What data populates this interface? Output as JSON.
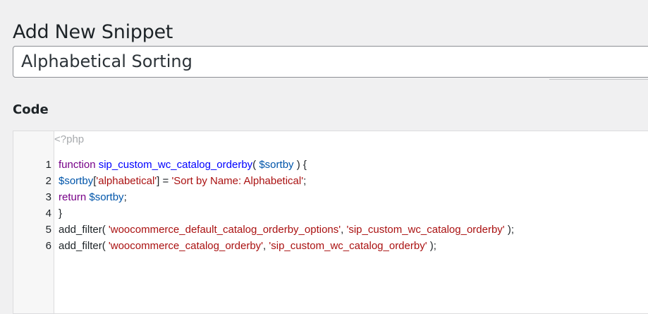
{
  "page": {
    "title": "Add New Snippet"
  },
  "snippet": {
    "title_value": "Alphabetical Sorting"
  },
  "code_section": {
    "label": "Code"
  },
  "editor": {
    "open_tag": "<?php",
    "lines": [
      {
        "num": "1",
        "tokens": [
          {
            "t": "function",
            "c": "kw"
          },
          {
            "t": " ",
            "c": "plain"
          },
          {
            "t": "sip_custom_wc_catalog_orderby",
            "c": "fn"
          },
          {
            "t": "( ",
            "c": "plain"
          },
          {
            "t": "$sortby",
            "c": "var"
          },
          {
            "t": " ) {",
            "c": "plain"
          }
        ]
      },
      {
        "num": "2",
        "tokens": [
          {
            "t": "$sortby",
            "c": "var"
          },
          {
            "t": "[",
            "c": "plain"
          },
          {
            "t": "'alphabetical'",
            "c": "str"
          },
          {
            "t": "] = ",
            "c": "plain"
          },
          {
            "t": "'Sort by Name: Alphabetical'",
            "c": "str"
          },
          {
            "t": ";",
            "c": "plain"
          }
        ]
      },
      {
        "num": "3",
        "tokens": [
          {
            "t": "return",
            "c": "kw"
          },
          {
            "t": " ",
            "c": "plain"
          },
          {
            "t": "$sortby",
            "c": "var"
          },
          {
            "t": ";",
            "c": "plain"
          }
        ]
      },
      {
        "num": "4",
        "tokens": [
          {
            "t": "}",
            "c": "plain"
          }
        ]
      },
      {
        "num": "5",
        "tokens": [
          {
            "t": "add_filter( ",
            "c": "plain"
          },
          {
            "t": "'woocommerce_default_catalog_orderby_options'",
            "c": "str"
          },
          {
            "t": ", ",
            "c": "plain"
          },
          {
            "t": "'sip_custom_wc_catalog_orderby'",
            "c": "str"
          },
          {
            "t": " );",
            "c": "plain"
          }
        ]
      },
      {
        "num": "6",
        "tokens": [
          {
            "t": "add_filter( ",
            "c": "plain"
          },
          {
            "t": "'woocommerce_catalog_orderby'",
            "c": "str"
          },
          {
            "t": ", ",
            "c": "plain"
          },
          {
            "t": "'sip_custom_wc_catalog_orderby'",
            "c": "str"
          },
          {
            "t": " );",
            "c": "plain"
          }
        ]
      }
    ]
  }
}
